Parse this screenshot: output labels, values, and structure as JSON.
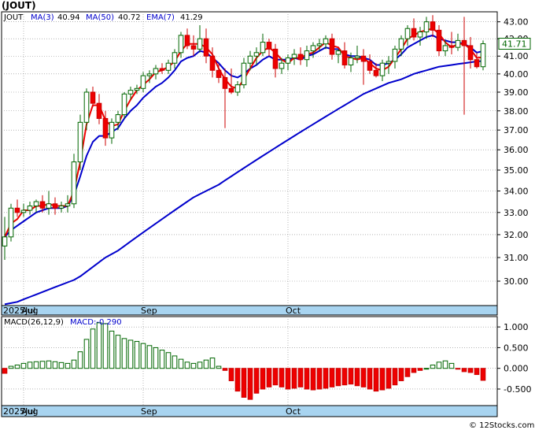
{
  "chart_data": [
    {
      "type": "candlestick",
      "title": "(JOUT)",
      "legend": {
        "symbol": "JOUT",
        "items": [
          {
            "name": "MA(3)",
            "value": "40.94",
            "color": "#ff0000"
          },
          {
            "name": "MA(50)",
            "value": "40.72",
            "color": "#0000cc"
          },
          {
            "name": "EMA(7)",
            "value": "41.29",
            "color": "#0000cc"
          }
        ]
      },
      "last_price_label": "41.71",
      "y_ticks": [
        "30.00",
        "31.00",
        "32.00",
        "33.00",
        "34.00",
        "35.00",
        "36.00",
        "37.00",
        "38.00",
        "39.00",
        "40.00",
        "41.00",
        "42.00",
        "43.00"
      ],
      "y_scale": "log",
      "ylim": [
        29.0,
        43.6
      ],
      "x_labels": [
        {
          "text": "2025Jul",
          "index": 0
        },
        {
          "text": "Aug",
          "index": 3
        },
        {
          "text": "Sep",
          "index": 22
        },
        {
          "text": "Oct",
          "index": 45
        }
      ],
      "candles": [
        [
          31.5,
          32.8,
          30.9,
          31.9
        ],
        [
          31.9,
          33.4,
          31.7,
          33.2
        ],
        [
          33.2,
          33.6,
          32.8,
          33.0
        ],
        [
          33.0,
          33.4,
          32.8,
          33.1
        ],
        [
          33.1,
          33.5,
          32.9,
          33.3
        ],
        [
          33.3,
          33.6,
          33.0,
          33.5
        ],
        [
          33.5,
          33.8,
          33.0,
          33.2
        ],
        [
          33.2,
          34.0,
          32.9,
          33.4
        ],
        [
          33.4,
          33.7,
          32.9,
          33.2
        ],
        [
          33.2,
          33.5,
          33.0,
          33.3
        ],
        [
          33.3,
          33.8,
          33.0,
          33.4
        ],
        [
          33.4,
          35.8,
          33.2,
          35.4
        ],
        [
          35.4,
          37.8,
          35.0,
          37.4
        ],
        [
          37.4,
          39.2,
          37.0,
          39.0
        ],
        [
          39.0,
          39.3,
          38.2,
          38.4
        ],
        [
          38.4,
          38.9,
          37.3,
          37.6
        ],
        [
          37.6,
          38.0,
          36.2,
          36.6
        ],
        [
          36.6,
          37.6,
          36.3,
          37.4
        ],
        [
          37.4,
          38.0,
          37.0,
          37.8
        ],
        [
          37.8,
          39.0,
          37.6,
          38.9
        ],
        [
          38.9,
          39.3,
          38.6,
          39.1
        ],
        [
          39.1,
          39.4,
          38.9,
          39.2
        ],
        [
          39.2,
          40.1,
          39.0,
          39.9
        ],
        [
          39.9,
          40.2,
          39.5,
          40.0
        ],
        [
          40.0,
          40.5,
          39.7,
          40.3
        ],
        [
          40.3,
          40.6,
          40.0,
          40.2
        ],
        [
          40.2,
          40.8,
          40.0,
          40.6
        ],
        [
          40.6,
          41.4,
          40.3,
          41.2
        ],
        [
          41.2,
          42.4,
          40.9,
          42.2
        ],
        [
          42.2,
          42.6,
          41.4,
          41.6
        ],
        [
          41.6,
          42.2,
          41.0,
          41.4
        ],
        [
          41.4,
          42.8,
          41.2,
          42.0
        ],
        [
          42.0,
          42.6,
          40.6,
          41.0
        ],
        [
          41.0,
          41.5,
          39.8,
          40.2
        ],
        [
          40.2,
          40.6,
          39.5,
          39.8
        ],
        [
          39.8,
          40.3,
          37.1,
          39.2
        ],
        [
          39.2,
          40.3,
          38.9,
          39.0
        ],
        [
          39.0,
          39.6,
          38.8,
          39.4
        ],
        [
          39.4,
          40.9,
          39.2,
          40.6
        ],
        [
          40.6,
          41.3,
          40.2,
          41.0
        ],
        [
          41.0,
          41.5,
          40.5,
          41.2
        ],
        [
          41.2,
          42.3,
          41.0,
          41.8
        ],
        [
          41.8,
          42.0,
          41.0,
          41.4
        ],
        [
          41.4,
          41.7,
          39.8,
          40.3
        ],
        [
          40.3,
          40.9,
          40.0,
          40.6
        ],
        [
          40.6,
          41.1,
          40.2,
          40.9
        ],
        [
          40.9,
          41.4,
          40.5,
          41.1
        ],
        [
          41.1,
          41.5,
          40.5,
          40.8
        ],
        [
          40.8,
          41.6,
          40.4,
          41.3
        ],
        [
          41.3,
          41.8,
          40.9,
          41.6
        ],
        [
          41.6,
          42.0,
          41.3,
          41.7
        ],
        [
          41.7,
          42.2,
          41.4,
          42.0
        ],
        [
          42.0,
          42.3,
          40.8,
          41.1
        ],
        [
          41.1,
          41.4,
          40.6,
          41.3
        ],
        [
          41.3,
          41.8,
          40.3,
          40.5
        ],
        [
          40.5,
          41.2,
          40.1,
          40.9
        ],
        [
          40.9,
          41.6,
          40.6,
          41.0
        ],
        [
          41.0,
          41.4,
          39.4,
          40.7
        ],
        [
          40.7,
          41.1,
          40.0,
          40.2
        ],
        [
          40.2,
          40.6,
          39.8,
          39.9
        ],
        [
          39.9,
          40.8,
          39.6,
          40.6
        ],
        [
          40.6,
          41.0,
          40.0,
          40.7
        ],
        [
          40.7,
          41.6,
          40.3,
          41.4
        ],
        [
          41.4,
          42.2,
          41.0,
          42.0
        ],
        [
          42.0,
          42.8,
          41.6,
          42.6
        ],
        [
          42.6,
          43.2,
          41.9,
          42.1
        ],
        [
          42.1,
          42.7,
          41.6,
          42.4
        ],
        [
          42.4,
          43.3,
          42.0,
          43.0
        ],
        [
          43.0,
          43.4,
          42.1,
          42.5
        ],
        [
          42.5,
          42.8,
          41.0,
          41.3
        ],
        [
          41.3,
          41.9,
          41.0,
          41.6
        ],
        [
          41.6,
          42.4,
          41.1,
          41.5
        ],
        [
          41.5,
          42.3,
          41.3,
          41.9
        ],
        [
          41.9,
          43.3,
          37.8,
          41.6
        ],
        [
          41.6,
          42.1,
          40.3,
          40.8
        ],
        [
          40.8,
          41.2,
          40.3,
          40.4
        ],
        [
          40.4,
          41.9,
          40.2,
          41.71
        ]
      ],
      "ma3": [
        31.9,
        32.5,
        32.7,
        33.1,
        33.1,
        33.3,
        33.3,
        33.4,
        33.3,
        33.3,
        33.3,
        34.0,
        35.4,
        37.3,
        38.3,
        38.3,
        37.5,
        37.2,
        37.3,
        38.0,
        38.6,
        39.1,
        39.4,
        39.7,
        40.1,
        40.2,
        40.4,
        40.7,
        41.3,
        41.7,
        41.7,
        41.7,
        41.5,
        41.1,
        40.3,
        39.7,
        39.3,
        39.2,
        39.7,
        40.3,
        40.9,
        41.3,
        41.5,
        41.2,
        40.8,
        40.6,
        40.9,
        40.9,
        41.1,
        41.2,
        41.5,
        41.8,
        41.6,
        41.5,
        41.0,
        40.9,
        40.8,
        40.9,
        40.6,
        40.3,
        40.2,
        40.4,
        40.9,
        41.4,
        42.0,
        42.2,
        42.4,
        42.5,
        42.6,
        42.3,
        41.8,
        41.5,
        41.7,
        41.7,
        41.4,
        40.9,
        40.94
      ],
      "ema7": [
        31.9,
        32.2,
        32.4,
        32.6,
        32.8,
        33.0,
        33.1,
        33.2,
        33.2,
        33.2,
        33.3,
        33.8,
        34.7,
        35.7,
        36.4,
        36.7,
        36.7,
        36.9,
        37.1,
        37.6,
        38.0,
        38.3,
        38.7,
        39.0,
        39.3,
        39.5,
        39.8,
        40.2,
        40.7,
        40.9,
        41.0,
        41.3,
        41.2,
        40.9,
        40.6,
        40.2,
        39.9,
        39.8,
        40.0,
        40.3,
        40.5,
        40.8,
        41.0,
        40.8,
        40.8,
        40.8,
        40.9,
        40.8,
        41.0,
        41.1,
        41.3,
        41.5,
        41.4,
        41.4,
        41.1,
        41.0,
        41.0,
        40.9,
        40.8,
        40.5,
        40.5,
        40.6,
        40.8,
        41.1,
        41.5,
        41.7,
        41.9,
        42.1,
        42.2,
        42.0,
        41.9,
        41.8,
        41.8,
        41.7,
        41.5,
        41.2,
        41.29
      ],
      "ma50_label_note": "",
      "ma50": [
        29.05,
        29.1,
        29.15,
        29.25,
        29.35,
        29.45,
        29.55,
        29.65,
        29.75,
        29.85,
        29.95,
        30.05,
        30.2,
        30.4,
        30.6,
        30.8,
        31.0,
        31.15,
        31.3,
        31.5,
        31.7,
        31.9,
        32.1,
        32.3,
        32.5,
        32.7,
        32.9,
        33.1,
        33.3,
        33.5,
        33.7,
        33.85,
        34.0,
        34.15,
        34.3,
        34.5,
        34.7,
        34.9,
        35.1,
        35.3,
        35.5,
        35.7,
        35.9,
        36.1,
        36.3,
        36.5,
        36.7,
        36.9,
        37.1,
        37.3,
        37.5,
        37.7,
        37.9,
        38.1,
        38.3,
        38.5,
        38.7,
        38.9,
        39.05,
        39.2,
        39.35,
        39.5,
        39.6,
        39.7,
        39.85,
        40.0,
        40.1,
        40.2,
        40.3,
        40.4,
        40.45,
        40.5,
        40.55,
        40.6,
        40.65,
        40.7,
        40.72
      ]
    },
    {
      "type": "bar",
      "title": "MACD(26,12,9)",
      "legend_value_label": "MACD:-0.290",
      "y_ticks": [
        "1.000",
        "0.500",
        "0.000",
        "-0.500"
      ],
      "ylim": [
        -0.9,
        1.25
      ],
      "values": [
        -0.12,
        0.05,
        0.08,
        0.12,
        0.15,
        0.16,
        0.17,
        0.18,
        0.16,
        0.14,
        0.12,
        0.2,
        0.4,
        0.7,
        0.95,
        1.1,
        1.08,
        0.9,
        0.8,
        0.72,
        0.68,
        0.65,
        0.6,
        0.55,
        0.5,
        0.44,
        0.38,
        0.3,
        0.22,
        0.15,
        0.12,
        0.15,
        0.2,
        0.25,
        0.05,
        -0.05,
        -0.3,
        -0.55,
        -0.7,
        -0.75,
        -0.6,
        -0.5,
        -0.45,
        -0.4,
        -0.45,
        -0.5,
        -0.48,
        -0.45,
        -0.5,
        -0.52,
        -0.5,
        -0.48,
        -0.45,
        -0.42,
        -0.4,
        -0.38,
        -0.42,
        -0.45,
        -0.5,
        -0.55,
        -0.52,
        -0.48,
        -0.4,
        -0.3,
        -0.2,
        -0.1,
        -0.05,
        0.0,
        0.08,
        0.15,
        0.18,
        0.12,
        -0.02,
        -0.08,
        -0.1,
        -0.15,
        -0.29
      ],
      "x_labels": [
        "2025Jul",
        "Aug",
        "Sep",
        "Oct"
      ]
    }
  ],
  "watermark": "© 12Stocks.com"
}
